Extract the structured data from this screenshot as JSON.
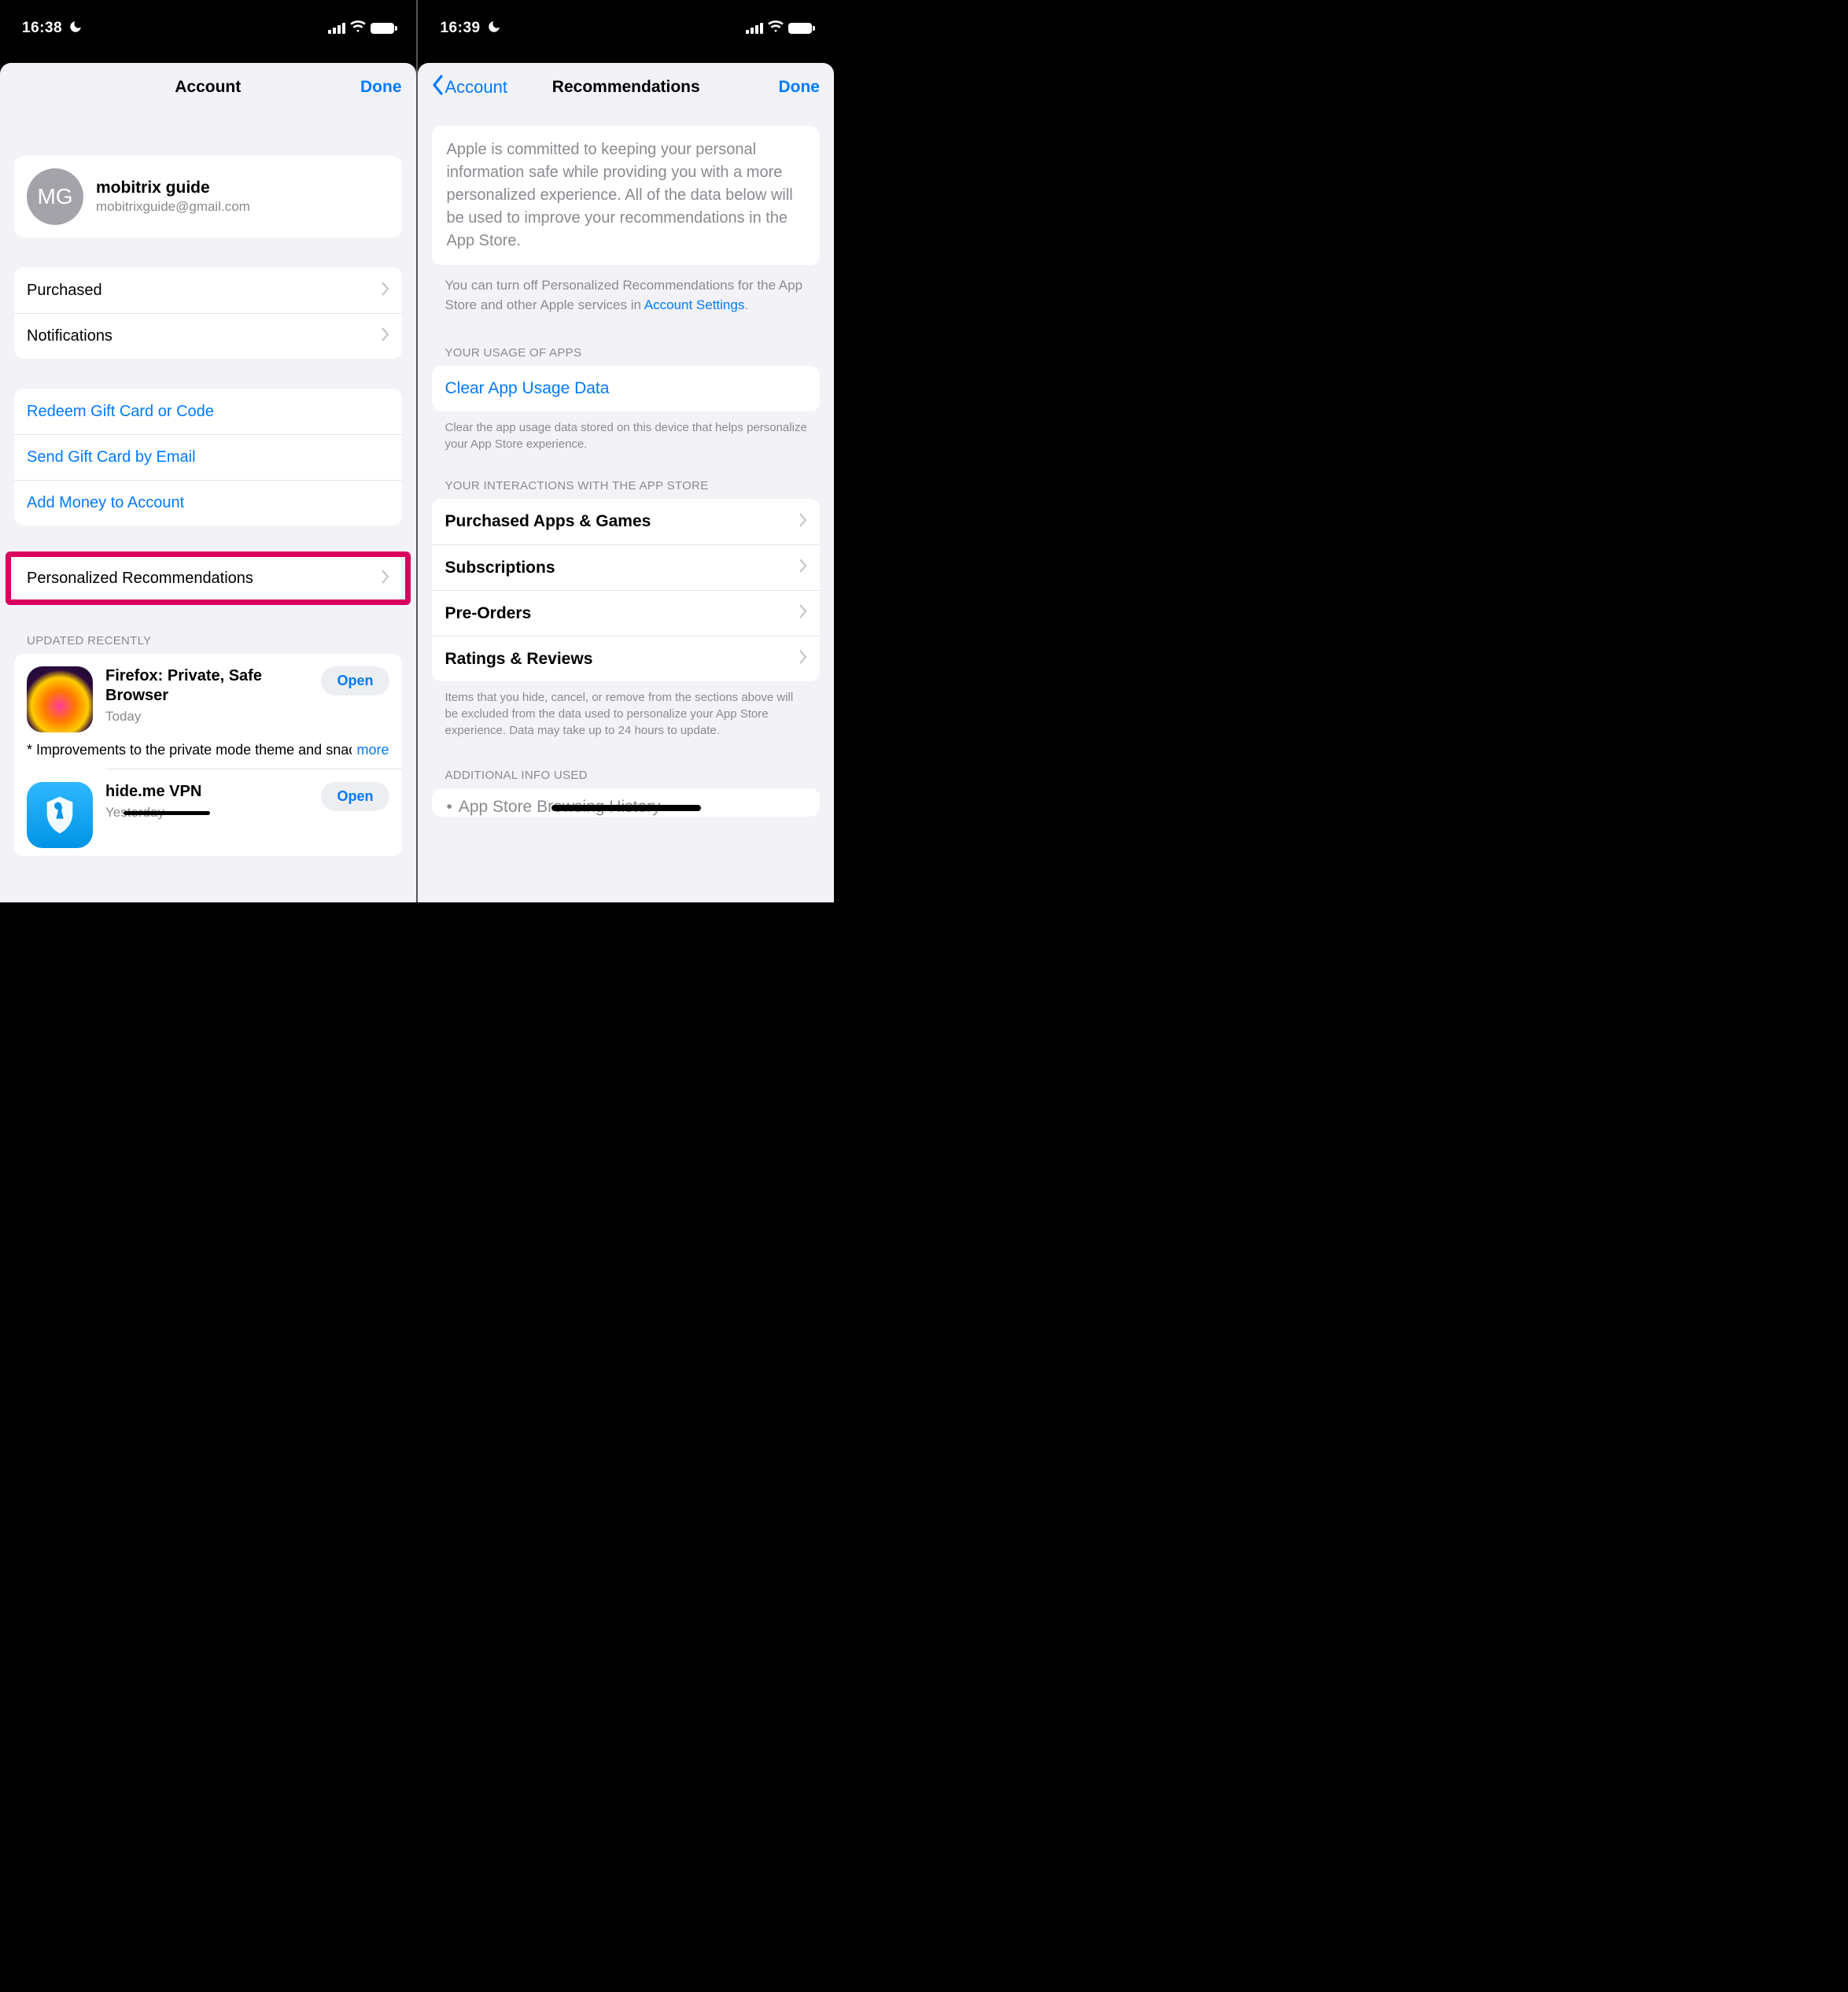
{
  "left": {
    "statusbar": {
      "time": "16:38"
    },
    "nav": {
      "title": "Account",
      "done": "Done"
    },
    "profile": {
      "initials": "MG",
      "name": "mobitrix guide",
      "email": "mobitrixguide@gmail.com"
    },
    "rows1": {
      "purchased": "Purchased",
      "notifications": "Notifications"
    },
    "rows2": {
      "redeem": "Redeem Gift Card or Code",
      "sendgift": "Send Gift Card by Email",
      "addmoney": "Add Money to Account"
    },
    "rows3": {
      "personalized": "Personalized Recommendations"
    },
    "updated_caption": "UPDATED RECENTLY",
    "apps": {
      "firefox": {
        "title": "Firefox: Private, Safe Browser",
        "time": "Today",
        "button": "Open",
        "notes": "* Improvements to the private mode theme and snackbar.",
        "more": "more"
      },
      "hideme": {
        "title": "hide.me VPN",
        "time": "Yesterday",
        "button": "Open"
      }
    }
  },
  "right": {
    "statusbar": {
      "time": "16:39"
    },
    "nav": {
      "back": "Account",
      "title": "Recommendations",
      "done": "Done"
    },
    "intro": "Apple is committed to keeping your personal information safe while providing you with a more personalized experience. All of the data below will be used to improve your recommendations in the App Store.",
    "sub_intro_pre": "You can turn off Personalized Recommendations for the App Store and other Apple services in ",
    "sub_intro_link": "Account Settings",
    "sub_intro_post": ".",
    "section1_caption": "YOUR USAGE OF APPS",
    "section1_row": "Clear App Usage Data",
    "section1_footer": "Clear the app usage data stored on this device that helps personalize your App Store experience.",
    "section2_caption": "YOUR INTERACTIONS WITH THE APP STORE",
    "section2_rows": {
      "purchased": "Purchased Apps & Games",
      "subscriptions": "Subscriptions",
      "preorders": "Pre-Orders",
      "ratings": "Ratings & Reviews"
    },
    "section2_footer": "Items that you hide, cancel, or remove from the sections above will be excluded from the data used to personalize your App Store experience. Data may take up to 24 hours to update.",
    "section3_caption": "ADDITIONAL INFO USED",
    "section3_item": "App Store Browsing History"
  }
}
